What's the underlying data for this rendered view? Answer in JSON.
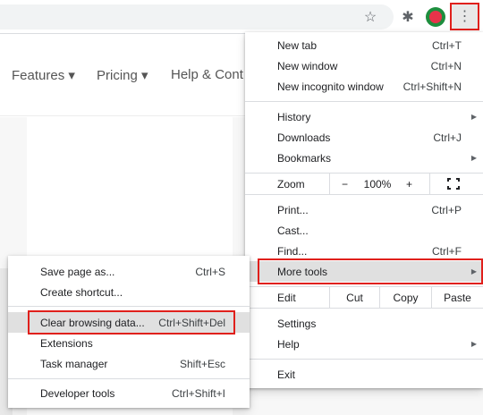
{
  "toolbar": {
    "star_icon": "☆",
    "extensions_icon": "✱",
    "menu_icon": "⋮"
  },
  "site": {
    "nav": [
      "Features ▾",
      "Pricing ▾",
      "Help & Cont"
    ]
  },
  "chrome_menu": {
    "new_tab": {
      "label": "New tab",
      "shortcut": "Ctrl+T"
    },
    "new_window": {
      "label": "New window",
      "shortcut": "Ctrl+N"
    },
    "new_incognito": {
      "label": "New incognito window",
      "shortcut": "Ctrl+Shift+N"
    },
    "history": {
      "label": "History"
    },
    "downloads": {
      "label": "Downloads",
      "shortcut": "Ctrl+J"
    },
    "bookmarks": {
      "label": "Bookmarks"
    },
    "zoom": {
      "label": "Zoom",
      "minus": "−",
      "value": "100%",
      "plus": "+"
    },
    "print": {
      "label": "Print...",
      "shortcut": "Ctrl+P"
    },
    "cast": {
      "label": "Cast..."
    },
    "find": {
      "label": "Find...",
      "shortcut": "Ctrl+F"
    },
    "more_tools": {
      "label": "More tools"
    },
    "edit": {
      "label": "Edit",
      "cut": "Cut",
      "copy": "Copy",
      "paste": "Paste"
    },
    "settings": {
      "label": "Settings"
    },
    "help": {
      "label": "Help"
    },
    "exit": {
      "label": "Exit"
    },
    "submenu_arrow": "▶"
  },
  "more_tools_menu": {
    "save_page": {
      "label": "Save page as...",
      "shortcut": "Ctrl+S"
    },
    "create_shortcut": {
      "label": "Create shortcut..."
    },
    "clear_browsing": {
      "label": "Clear browsing data...",
      "shortcut": "Ctrl+Shift+Del"
    },
    "extensions": {
      "label": "Extensions"
    },
    "task_manager": {
      "label": "Task manager",
      "shortcut": "Shift+Esc"
    },
    "developer_tools": {
      "label": "Developer tools",
      "shortcut": "Ctrl+Shift+I"
    }
  },
  "colors": {
    "highlight_box": "#e0201c",
    "menu_hover": "#e0e0e0"
  }
}
